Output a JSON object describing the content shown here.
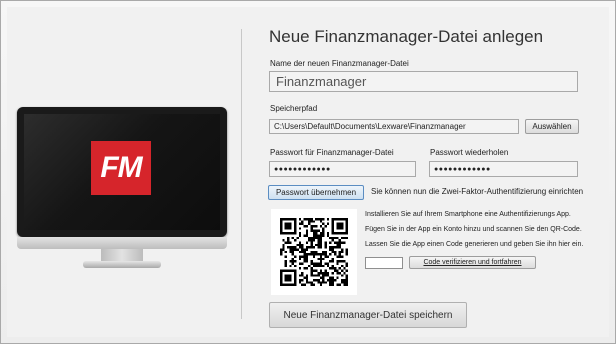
{
  "dialog": {
    "title": "Neue Finanzmanager-Datei anlegen",
    "name_label": "Name der neuen Finanzmanager-Datei",
    "name_value": "Finanzmanager",
    "path_label": "Speicherpfad",
    "path_value": "C:\\Users\\Default\\Documents\\Lexware\\Finanzmanager",
    "browse_button": "Auswählen",
    "password_label": "Passwort für Finanzmanager-Datei",
    "password_value": "●●●●●●●●●●●●",
    "password_repeat_label": "Passwort wiederholen",
    "password_repeat_value": "●●●●●●●●●●●●",
    "apply_password_button": "Passwort übernehmen",
    "two_factor_hint": "Sie können nun die Zwei-Faktor-Authentifizierung einrichten",
    "instructions": [
      "Installieren Sie auf Ihrem Smartphone eine Authentifizierungs App.",
      "Fügen Sie in der App ein Konto hinzu und scannen Sie den QR-Code.",
      "Lassen Sie die App einen Code generieren und geben Sie ihn hier ein."
    ],
    "verify_button": "Code verifizieren und fortfahren",
    "save_button": "Neue Finanzmanager-Datei speichern"
  },
  "logo": {
    "text": "FM",
    "color": "#d6252b"
  }
}
